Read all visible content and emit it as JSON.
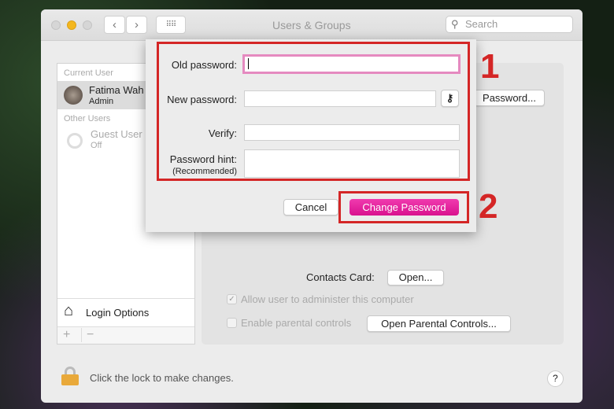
{
  "window": {
    "title": "Users & Groups",
    "search_placeholder": "Search"
  },
  "sidebar": {
    "current_user_header": "Current User",
    "current_user": {
      "name": "Fatima Wah",
      "role": "Admin"
    },
    "other_users_header": "Other Users",
    "other_users": [
      {
        "name": "Guest User",
        "status": "Off"
      }
    ],
    "login_options": "Login Options",
    "add": "+",
    "remove": "−"
  },
  "main": {
    "change_password_button": "Password...",
    "contacts_card_label": "Contacts Card:",
    "open_button": "Open...",
    "allow_admin": {
      "label": "Allow user to administer this computer",
      "checked": true
    },
    "parental": {
      "label": "Enable parental controls",
      "checked": false
    },
    "open_parental_button": "Open Parental Controls..."
  },
  "footer": {
    "lock_text": "Click the lock to make changes.",
    "help": "?"
  },
  "dialog": {
    "old_password_label": "Old password:",
    "new_password_label": "New password:",
    "verify_label": "Verify:",
    "hint_label": "Password hint:",
    "hint_sub": "(Recommended)",
    "old_password": "",
    "new_password": "",
    "verify": "",
    "hint": "",
    "cancel": "Cancel",
    "change_password": "Change Password",
    "accent": "#e8179a"
  },
  "annotations": [
    "1",
    "2"
  ]
}
